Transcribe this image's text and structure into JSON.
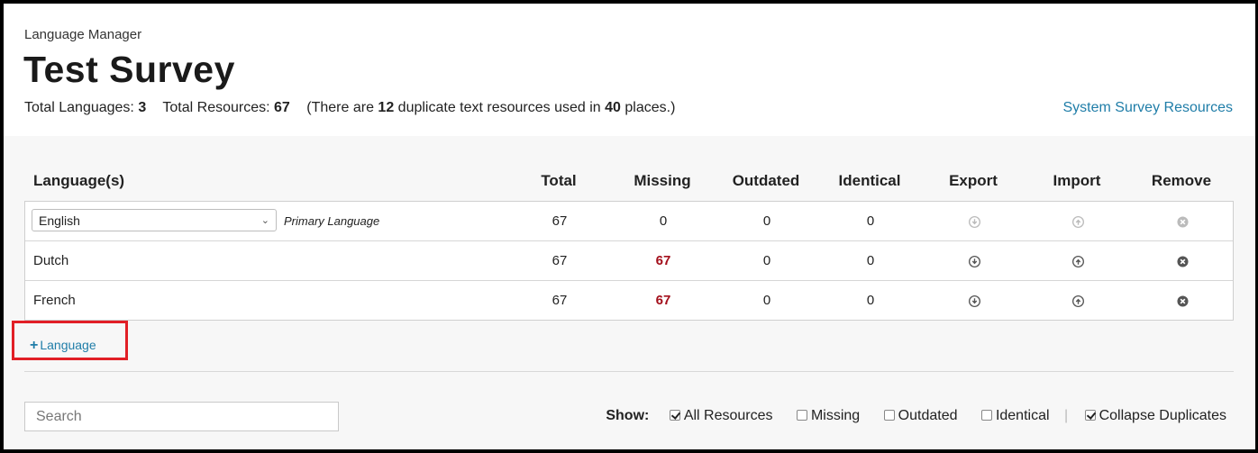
{
  "breadcrumb": "Language Manager",
  "title": "Test Survey",
  "stats": {
    "total_languages_label": "Total Languages:",
    "total_languages": "3",
    "total_resources_label": "Total Resources:",
    "total_resources": "67",
    "dup_prefix": "(There are",
    "dup_count": "12",
    "dup_middle": "duplicate text resources used in",
    "dup_places": "40",
    "dup_suffix": "places.)"
  },
  "system_link": "System Survey Resources",
  "columns": {
    "language": "Language(s)",
    "total": "Total",
    "missing": "Missing",
    "outdated": "Outdated",
    "identical": "Identical",
    "export": "Export",
    "import": "Import",
    "remove": "Remove"
  },
  "rows": [
    {
      "name": "English",
      "primary_label": "Primary Language",
      "total": "67",
      "missing": "0",
      "outdated": "0",
      "identical": "0"
    },
    {
      "name": "Dutch",
      "total": "67",
      "missing": "67",
      "outdated": "0",
      "identical": "0"
    },
    {
      "name": "French",
      "total": "67",
      "missing": "67",
      "outdated": "0",
      "identical": "0"
    }
  ],
  "add_language": "Language",
  "search_placeholder": "Search",
  "filters": {
    "show_label": "Show:",
    "options": [
      {
        "label": "All Resources",
        "checked": true
      },
      {
        "label": "Missing",
        "checked": false
      },
      {
        "label": "Outdated",
        "checked": false
      },
      {
        "label": "Identical",
        "checked": false
      },
      {
        "label": "Collapse Duplicates",
        "checked": true
      }
    ],
    "separator": "|"
  },
  "colors": {
    "link": "#1f7da8",
    "missing_red": "#a30f1b",
    "highlight": "#e11f26",
    "icon_active": "#555555",
    "icon_disabled": "#bbbbbb"
  }
}
